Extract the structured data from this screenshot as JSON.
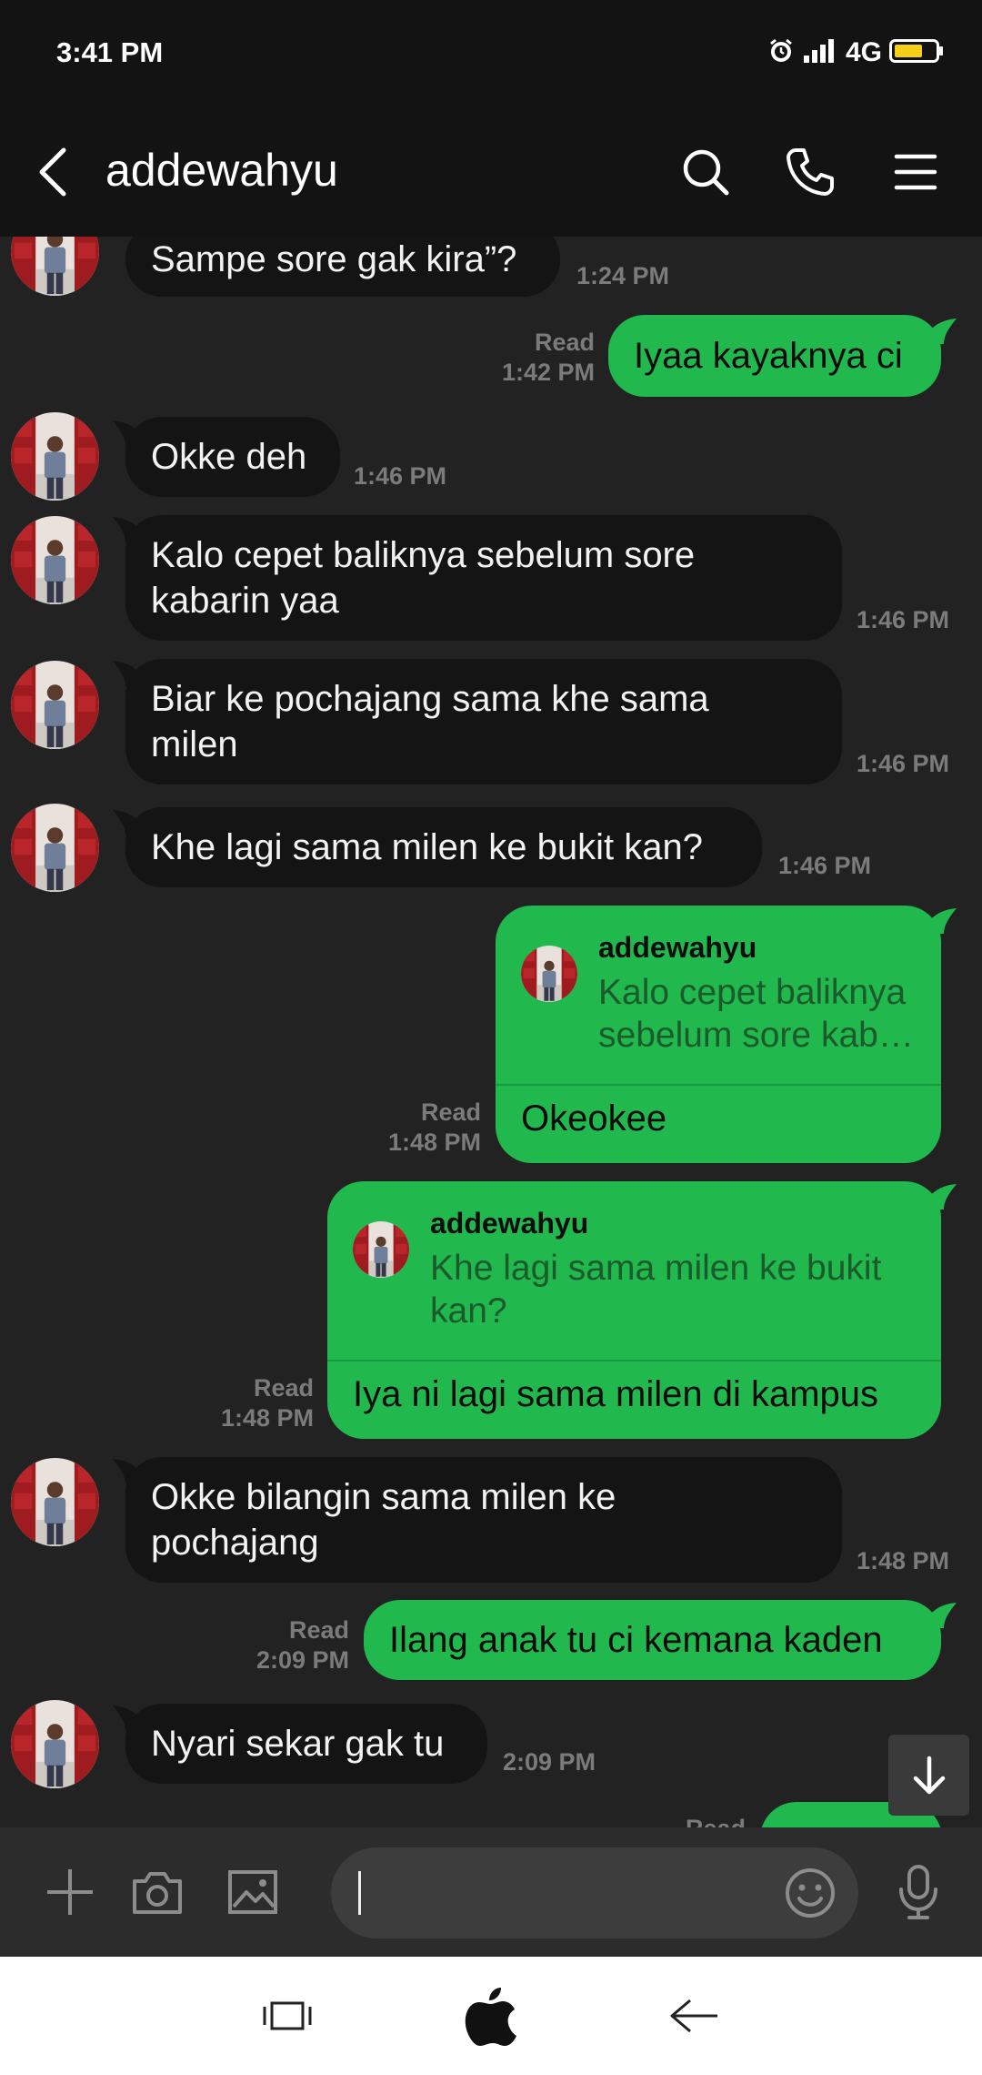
{
  "status_bar": {
    "time": "3:41 PM",
    "network": "4G",
    "battery_color": "#f5d019"
  },
  "header": {
    "title": "addewahyu"
  },
  "colors": {
    "incoming_bubble": "#141414",
    "outgoing_bubble": "#21b94e",
    "background": "#222222"
  },
  "messages": [
    {
      "dir": "in",
      "text": "Sampe sore gak kira”?",
      "time": "1:24 PM"
    },
    {
      "dir": "out",
      "text": "Iyaa kayaknya ci",
      "read": "Read",
      "time": "1:42 PM"
    },
    {
      "dir": "in",
      "text": "Okke deh",
      "time": "1:46 PM"
    },
    {
      "dir": "in",
      "line1": "Kalo cepet baliknya sebelum sore",
      "line2": "kabarin yaa",
      "time": "1:46 PM"
    },
    {
      "dir": "in",
      "line1": "Biar ke pochajang sama khe sama",
      "line2": "milen",
      "time": "1:46 PM"
    },
    {
      "dir": "in",
      "text": "Khe lagi sama milen ke bukit kan?",
      "time": "1:46 PM"
    },
    {
      "dir": "out",
      "reply_name": "addewahyu",
      "reply_line1": "Kalo cepet baliknya",
      "reply_line2": "sebelum sore kab…",
      "text": "Okeokee",
      "read": "Read",
      "time": "1:48 PM"
    },
    {
      "dir": "out",
      "reply_name": "addewahyu",
      "reply_line1": "Khe lagi sama milen ke bukit",
      "reply_line2": "kan?",
      "text": "Iya ni lagi sama milen di kampus",
      "read": "Read",
      "time": "1:48 PM"
    },
    {
      "dir": "in",
      "line1": "Okke bilangin sama milen ke",
      "line2": "pochajang",
      "time": "1:48 PM"
    },
    {
      "dir": "out",
      "text": "Ilang anak tu ci kemana kaden",
      "read": "Read",
      "time": "2:09 PM"
    },
    {
      "dir": "in",
      "text": "Nyari sekar gak tu",
      "time": "2:09 PM"
    },
    {
      "dir": "out",
      "read": "Read"
    }
  ],
  "icons": {
    "back": "chevron-left-icon",
    "search": "search-icon",
    "call": "phone-icon",
    "menu": "menu-icon",
    "plus": "plus-icon",
    "camera": "camera-icon",
    "gallery": "image-icon",
    "emoji": "emoji-icon",
    "mic": "microphone-icon",
    "scroll_down": "arrow-down-icon",
    "nav_recent": "recent-apps-icon",
    "nav_home": "apple-logo-icon",
    "nav_back": "nav-back-icon"
  }
}
